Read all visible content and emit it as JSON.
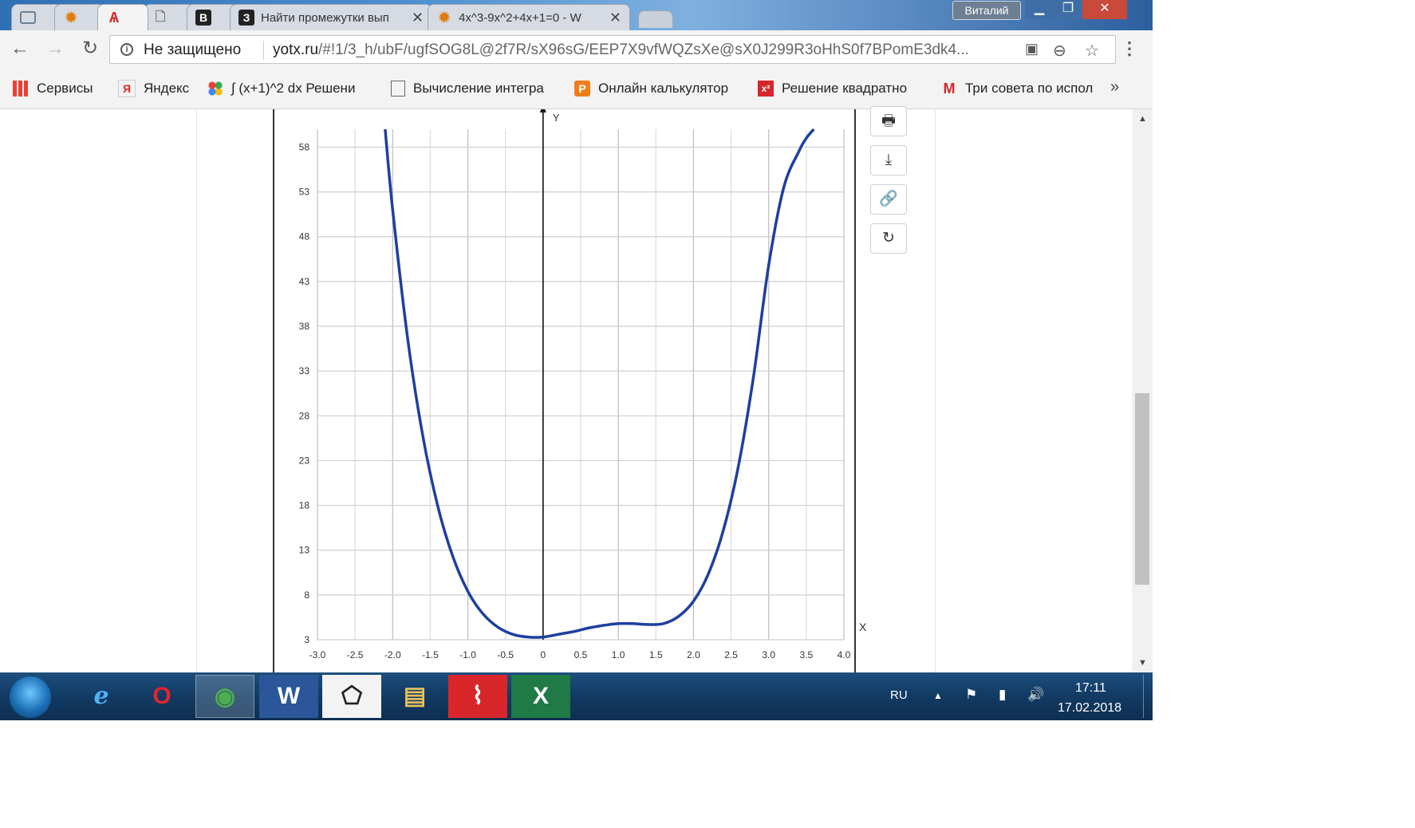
{
  "browser": {
    "tabs": [
      {
        "label": "",
        "icon": "monitor-icon"
      },
      {
        "label": "",
        "icon": "sun-icon"
      },
      {
        "label": "",
        "icon": "red-letter-icon"
      },
      {
        "label": "",
        "icon": "page-icon"
      },
      {
        "label": "",
        "icon": "b-letter-icon"
      },
      {
        "label": "Найти промежутки вып",
        "icon": "z-letter-icon"
      },
      {
        "label": "4x^3-9x^2+4x+1=0 - W",
        "icon": "sun-icon"
      }
    ],
    "profile_name": "Виталий",
    "security_label": "Не защищено",
    "url_host": "yotx.ru",
    "url_path": "/#!1/3_h/ubF/ugfSOG8L@2f7R/sX96sG/EEP7X9vfWQZsXe@sX0J299R3oHhS0f7BPomE3dk4...",
    "bookmarks": [
      {
        "label": "Сервисы",
        "icon": "apps-grid-icon"
      },
      {
        "label": "Яндекс",
        "icon": "yandex-icon"
      },
      {
        "label": "∫ (x+1)^2 dx Решени",
        "icon": "colored-dots-icon"
      },
      {
        "label": "Вычисление интегра",
        "icon": "page-icon"
      },
      {
        "label": "Онлайн калькулятор",
        "icon": "orange-p-icon"
      },
      {
        "label": "Решение квадратно",
        "icon": "red-x2-icon"
      },
      {
        "label": "Три совета по испол",
        "icon": "gmail-icon"
      }
    ]
  },
  "side_tools": [
    {
      "name": "print-button",
      "icon": "🖶"
    },
    {
      "name": "download-button",
      "icon": "⤓"
    },
    {
      "name": "link-button",
      "icon": "🔗"
    },
    {
      "name": "share-button",
      "icon": "↻"
    }
  ],
  "chart_data": {
    "type": "line",
    "title": "",
    "xlabel": "X",
    "ylabel": "Y",
    "xlim": [
      -3.0,
      4.0
    ],
    "ylim": [
      3,
      60
    ],
    "xticks": [
      "-3.0",
      "-2.5",
      "-2.0",
      "-1.5",
      "-1.0",
      "-0.5",
      "0",
      "0.5",
      "1.0",
      "1.5",
      "2.0",
      "2.5",
      "3.0",
      "3.5",
      "4.0"
    ],
    "yticks": [
      "3",
      "8",
      "13",
      "18",
      "23",
      "28",
      "33",
      "38",
      "43",
      "48",
      "53",
      "58"
    ],
    "grid": true,
    "color": "#1f3fa0",
    "series": [
      {
        "name": "",
        "x": [
          -2.1,
          -2.0,
          -1.8,
          -1.6,
          -1.4,
          -1.2,
          -1.0,
          -0.8,
          -0.6,
          -0.4,
          -0.2,
          0.0,
          0.2,
          0.4,
          0.6,
          0.8,
          1.0,
          1.2,
          1.4,
          1.6,
          1.8,
          2.0,
          2.2,
          2.4,
          2.6,
          2.8,
          3.0,
          3.2,
          3.4,
          3.5,
          3.6
        ],
        "y": [
          60,
          51,
          36.6,
          25.8,
          17.9,
          12.3,
          8.4,
          5.9,
          4.4,
          3.6,
          3.3,
          3.3,
          3.6,
          3.9,
          4.3,
          4.6,
          4.8,
          4.8,
          4.7,
          4.8,
          5.6,
          7.3,
          10.4,
          15.3,
          22.5,
          32.5,
          44.8,
          53.5,
          57.5,
          59.0,
          60
        ]
      }
    ]
  },
  "taskbar": {
    "apps": [
      {
        "name": "ie-app",
        "glyph": "e"
      },
      {
        "name": "opera-app",
        "glyph": "O"
      },
      {
        "name": "chrome-app",
        "glyph": "◉"
      },
      {
        "name": "word-app",
        "glyph": "W"
      },
      {
        "name": "geogebra-app",
        "glyph": "⬠"
      },
      {
        "name": "explorer-app",
        "glyph": "▤"
      },
      {
        "name": "pdf-app",
        "glyph": "⌇"
      },
      {
        "name": "excel-app",
        "glyph": "X"
      }
    ],
    "language": "RU",
    "time": "17:11",
    "date": "17.02.2018"
  }
}
